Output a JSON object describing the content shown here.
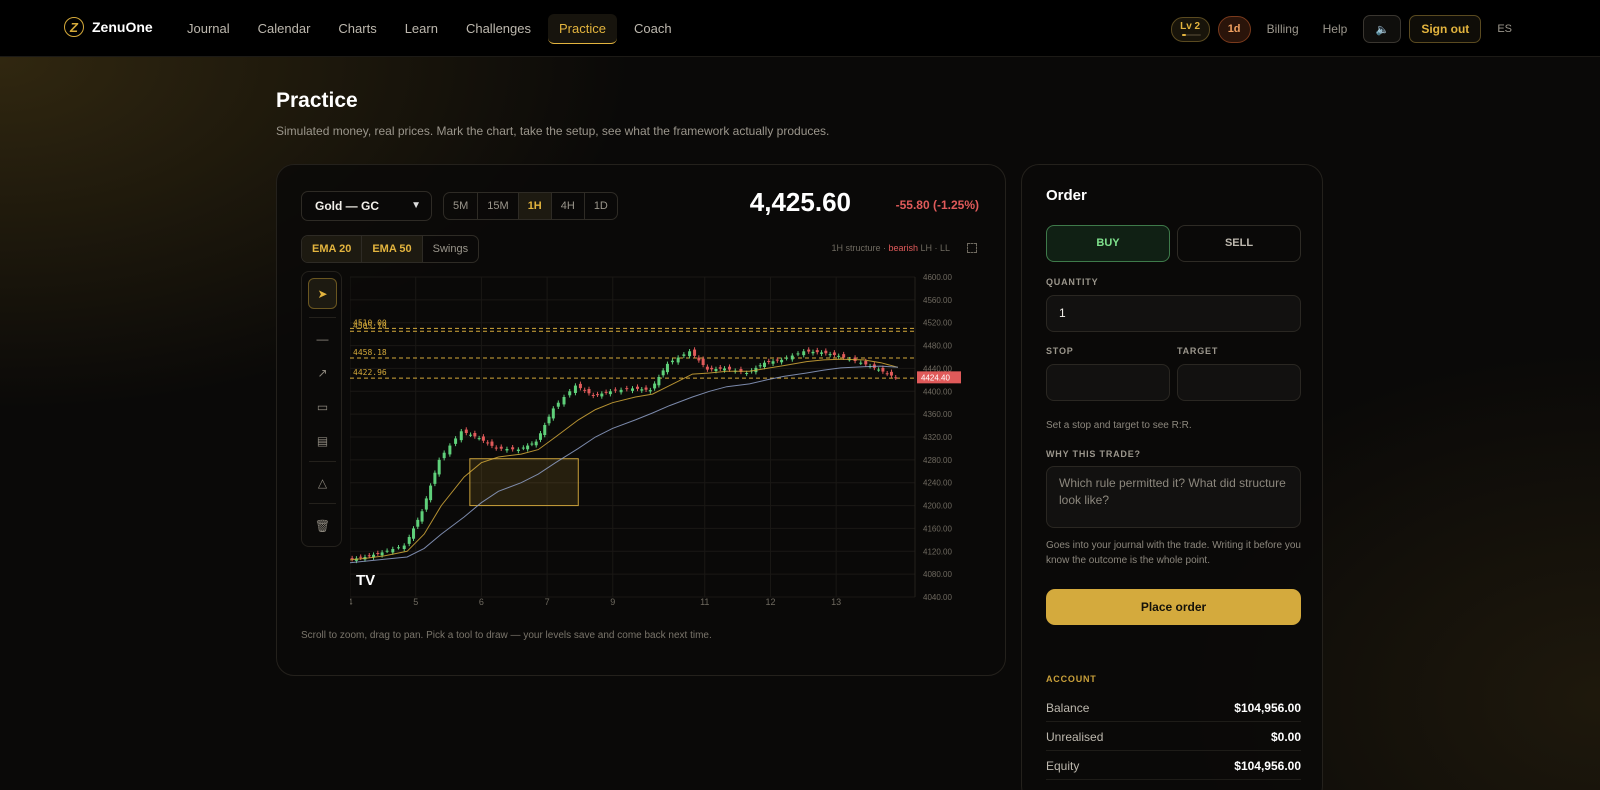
{
  "app": {
    "name": "ZenuOne",
    "logo_letter": "Z"
  },
  "nav": {
    "links": [
      "Journal",
      "Calendar",
      "Charts",
      "Learn",
      "Challenges",
      "Practice",
      "Coach"
    ],
    "active": "Practice",
    "level": "Lv 2",
    "level_progress": 0.25,
    "streak": "1d",
    "billing": "Billing",
    "help": "Help",
    "sign_out": "Sign out",
    "lang": "ES"
  },
  "header": {
    "title": "Practice",
    "subtitle": "Simulated money, real prices. Mark the chart, take the setup, see what the framework actually produces."
  },
  "chart_panel": {
    "symbol": "Gold — GC",
    "timeframes": [
      "5M",
      "15M",
      "1H",
      "4H",
      "1D"
    ],
    "active_timeframe": "1H",
    "price": "4,425.60",
    "change": "-55.80 (-1.25%)",
    "indicators": [
      "EMA 20",
      "EMA 50",
      "Swings"
    ],
    "active_indicators": [
      "EMA 20",
      "EMA 50"
    ],
    "structure_label": "1H structure · ",
    "structure_state": "bearish",
    "structure_detail": " LH · LL",
    "hint": "Scroll to zoom, drag to pan. Pick a tool to draw — your levels save and come back next time.",
    "tools": [
      "cursor-icon",
      "horizontal-line-icon",
      "trendline-icon",
      "rectangle-icon",
      "range-icon",
      "eraser-icon",
      "trash-icon"
    ]
  },
  "chart_data": {
    "type": "line",
    "title": "",
    "x_ticks": [
      "4",
      "5",
      "6",
      "7",
      "9",
      "11",
      "12",
      "13"
    ],
    "y_ticks": [
      "4600.00",
      "4560.00",
      "4520.00",
      "4480.00",
      "4440.00",
      "4400.00",
      "4360.00",
      "4320.00",
      "4280.00",
      "4240.00",
      "4200.00",
      "4160.00",
      "4120.00",
      "4080.00",
      "4040.00"
    ],
    "ylim": [
      4040,
      4600
    ],
    "levels": [
      {
        "label": "4510.00",
        "value": 4510
      },
      {
        "label": "4505.10",
        "value": 4505
      },
      {
        "label": "4458.18",
        "value": 4458.18
      },
      {
        "label": "4422.96",
        "value": 4422.96
      }
    ],
    "last_price_label": "4424.40",
    "last_price": 4424.4,
    "zone": {
      "x_from": 6.1,
      "x_to": 8.0,
      "y_from": 4200,
      "y_to": 4282
    },
    "series": [
      {
        "x": [
          4.0,
          4.3,
          4.6,
          5.0,
          5.3,
          5.6,
          6.0,
          6.3,
          6.6,
          7.0,
          7.3,
          7.6,
          8.0,
          8.3,
          8.6,
          9.0,
          9.3,
          9.6,
          10.0,
          10.3,
          10.6,
          11.0,
          11.3,
          11.6,
          12.0,
          12.3,
          12.6,
          13.0,
          13.3,
          13.6
        ],
        "values": [
          4105,
          4110,
          4118,
          4130,
          4190,
          4280,
          4330,
          4318,
          4300,
          4298,
          4312,
          4370,
          4410,
          4392,
          4400,
          4405,
          4402,
          4448,
          4470,
          4438,
          4440,
          4432,
          4450,
          4455,
          4470,
          4468,
          4462,
          4450,
          4438,
          4424
        ]
      },
      {
        "name": "EMA 20",
        "x": [
          4.0,
          4.3,
          4.6,
          5.0,
          5.3,
          5.6,
          6.0,
          6.3,
          6.6,
          7.0,
          7.3,
          7.6,
          8.0,
          8.3,
          8.6,
          9.0,
          9.3,
          9.6,
          10.0,
          10.3,
          10.6,
          11.0,
          11.3,
          11.6,
          12.0,
          12.3,
          12.6,
          13.0,
          13.3,
          13.6
        ],
        "values": [
          4105,
          4108,
          4112,
          4120,
          4150,
          4200,
          4250,
          4275,
          4285,
          4290,
          4298,
          4320,
          4350,
          4368,
          4380,
          4390,
          4395,
          4410,
          4430,
          4432,
          4435,
          4435,
          4440,
          4445,
          4452,
          4455,
          4456,
          4455,
          4450,
          4442
        ]
      },
      {
        "name": "EMA 50",
        "x": [
          4.0,
          4.3,
          4.6,
          5.0,
          5.3,
          5.6,
          6.0,
          6.3,
          6.6,
          7.0,
          7.3,
          7.6,
          8.0,
          8.3,
          8.6,
          9.0,
          9.3,
          9.6,
          10.0,
          10.3,
          10.6,
          11.0,
          11.3,
          11.6,
          12.0,
          12.3,
          12.6,
          13.0,
          13.3,
          13.6
        ],
        "values": [
          4100,
          4103,
          4106,
          4110,
          4125,
          4150,
          4180,
          4205,
          4225,
          4240,
          4255,
          4275,
          4300,
          4320,
          4335,
          4350,
          4362,
          4375,
          4390,
          4400,
          4408,
          4413,
          4420,
          4426,
          4432,
          4437,
          4441,
          4443,
          4444,
          4442
        ]
      }
    ]
  },
  "order": {
    "title": "Order",
    "buy": "BUY",
    "sell": "SELL",
    "quantity_label": "QUANTITY",
    "quantity": "1",
    "stop_label": "STOP",
    "target_label": "TARGET",
    "rr_hint": "Set a stop and target to see R:R.",
    "why_label": "WHY THIS TRADE?",
    "why_placeholder": "Which rule permitted it? What did structure look like?",
    "journal_hint": "Goes into your journal with the trade. Writing it before you know the outcome is the whole point.",
    "place_order": "Place order"
  },
  "account": {
    "title": "ACCOUNT",
    "rows": [
      {
        "label": "Balance",
        "value": "$104,956.00"
      },
      {
        "label": "Unrealised",
        "value": "$0.00"
      },
      {
        "label": "Equity",
        "value": "$104,956.00"
      }
    ]
  },
  "colors": {
    "accent": "#e3b43e",
    "up": "#5fd07a",
    "down": "#e05a5a",
    "ema20": "#d4a93a",
    "ema50": "#8fa0c8"
  }
}
